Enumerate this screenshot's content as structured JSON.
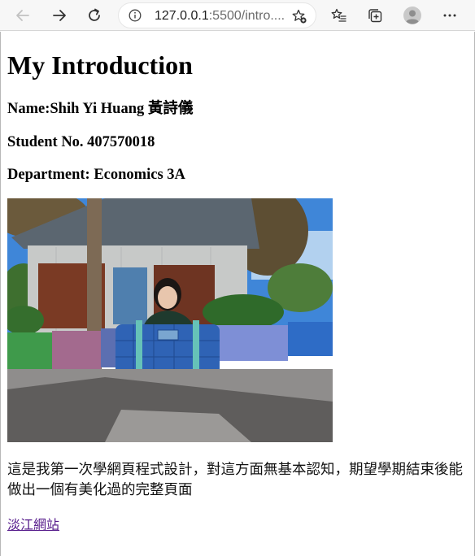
{
  "browser": {
    "url_host": "127.0.0.1",
    "url_rest": ":5500/intro....",
    "icons": {
      "back": "arrow-left-icon",
      "forward": "arrow-right-icon",
      "reload": "reload-icon",
      "info": "info-icon",
      "add_favorite": "star-plus-icon",
      "favorites": "favorites-list-icon",
      "collections": "collections-icon",
      "profile": "profile-avatar-icon",
      "more": "more-dots-icon"
    }
  },
  "page": {
    "title": "My Introduction",
    "name_line": "Name:Shih Yi Huang 黃詩儀",
    "student_line": "Student No. 407570018",
    "department_line": "Department: Economics 3A",
    "photo": "photo-of-student-sitting-behind-blue-bag-outdoors",
    "paragraph": "這是我第一次學網頁程式設計，對這方面無基本認知，期望學期結束後能做出一個有美化過的完整頁面",
    "link_text": "淡江網站"
  },
  "colors": {
    "link_visited": "#551a8b",
    "toolbar_bg": "#f7f7f7"
  }
}
